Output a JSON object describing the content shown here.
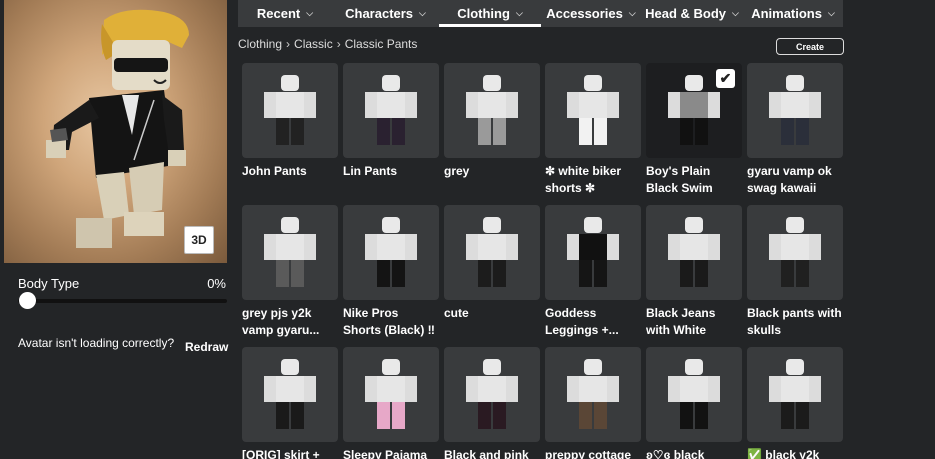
{
  "nav": {
    "tabs": [
      {
        "label": "Recent",
        "active": false
      },
      {
        "label": "Characters",
        "active": false
      },
      {
        "label": "Clothing",
        "active": true
      },
      {
        "label": "Accessories",
        "active": false
      },
      {
        "label": "Head & Body",
        "active": false
      },
      {
        "label": "Animations",
        "active": false
      }
    ]
  },
  "breadcrumb": [
    "Clothing",
    "Classic",
    "Classic Pants"
  ],
  "create_label": "Create",
  "avatar": {
    "view_mode_label": "3D"
  },
  "body_type": {
    "label": "Body Type",
    "value": "0%",
    "level": 0
  },
  "loading": {
    "text": "Avatar isn't loading correctly?",
    "action": "Redraw"
  },
  "items": [
    {
      "name": "John Pants",
      "selected": false,
      "pants": "#222222",
      "top": "#e6e6e6"
    },
    {
      "name": "Lin Pants",
      "selected": false,
      "pants": "#2a2130",
      "top": "#e6e6e6"
    },
    {
      "name": "grey",
      "selected": false,
      "pants": "#9a9a9a",
      "top": "#e6e6e6"
    },
    {
      "name": "✼ white biker shorts ✼",
      "selected": false,
      "pants": "#f2f2f2",
      "top": "#e6e6e6"
    },
    {
      "name": "Boy's Plain Black Swim Shorts -...",
      "selected": true,
      "pants": "#111111",
      "top": "#8a8a8a"
    },
    {
      "name": "gyaru vamp ok swag kawaii sof...",
      "selected": false,
      "pants": "#2b2f3a",
      "top": "#e6e6e6"
    },
    {
      "name": "grey pjs y2k vamp gyaru...",
      "selected": false,
      "pants": "#5a5a5a",
      "top": "#e6e6e6"
    },
    {
      "name": "Nike Pros Shorts (Black) ‼ ☆ ° .",
      "selected": false,
      "pants": "#141414",
      "top": "#e6e6e6"
    },
    {
      "name": "cute",
      "selected": false,
      "pants": "#1c1c1c",
      "top": "#e6e6e6"
    },
    {
      "name": "Goddess Leggings +...",
      "selected": false,
      "pants": "#151515",
      "top": "#111111"
    },
    {
      "name": "Black Jeans with White Shoes",
      "selected": false,
      "pants": "#1a1a1a",
      "top": "#e6e6e6"
    },
    {
      "name": "Black pants with skulls",
      "selected": false,
      "pants": "#202020",
      "top": "#e6e6e6"
    },
    {
      "name": "[ORIG] skirt +",
      "selected": false,
      "pants": "#1a1a1a",
      "top": "#e6e6e6"
    },
    {
      "name": "Sleepy Pajama",
      "selected": false,
      "pants": "#e7a8c8",
      "top": "#e6e6e6"
    },
    {
      "name": "Black and pink",
      "selected": false,
      "pants": "#2a1a22",
      "top": "#e6e6e6"
    },
    {
      "name": "preppy cottage",
      "selected": false,
      "pants": "#5a4636",
      "top": "#e6e6e6"
    },
    {
      "name": "ʚ♡ɞ black",
      "selected": false,
      "pants": "#121212",
      "top": "#e6e6e6"
    },
    {
      "name": "✅ black y2k",
      "selected": false,
      "pants": "#1b1b1b",
      "top": "#e6e6e6"
    }
  ]
}
